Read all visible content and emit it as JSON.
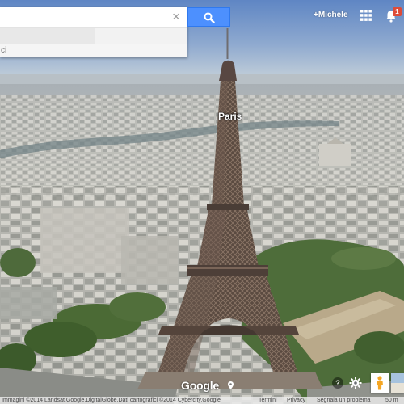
{
  "search": {
    "value": "",
    "placeholder": "",
    "clear_symbol": "×",
    "footer_text": "ci"
  },
  "account": {
    "name": "+Michele",
    "notification_count": "1"
  },
  "map": {
    "place_label": "Paris",
    "view": "3D satellite"
  },
  "controls": {
    "logo_text": "Google",
    "help_label": "?"
  },
  "attribution": {
    "imagery": "Immagini ©2014 Landsat,Google,DigitalGlobe,Dati cartografici ©2014 Cybercity,Google",
    "terms": "Termini",
    "privacy": "Privacy",
    "report": "Segnala un problema",
    "scale": "50 m"
  },
  "colors": {
    "search_button": "#4d90fe",
    "notification_badge": "#dd4b39",
    "sky_top": "#5f86c4",
    "sky_horizon": "#c3cfd9"
  },
  "icons": {
    "search": "search-icon",
    "clear": "close-icon",
    "apps": "apps-grid-icon",
    "notifications": "bell-icon",
    "help": "help-icon",
    "settings": "gear-icon",
    "streetview": "pegman-icon",
    "location": "map-pin-icon"
  }
}
